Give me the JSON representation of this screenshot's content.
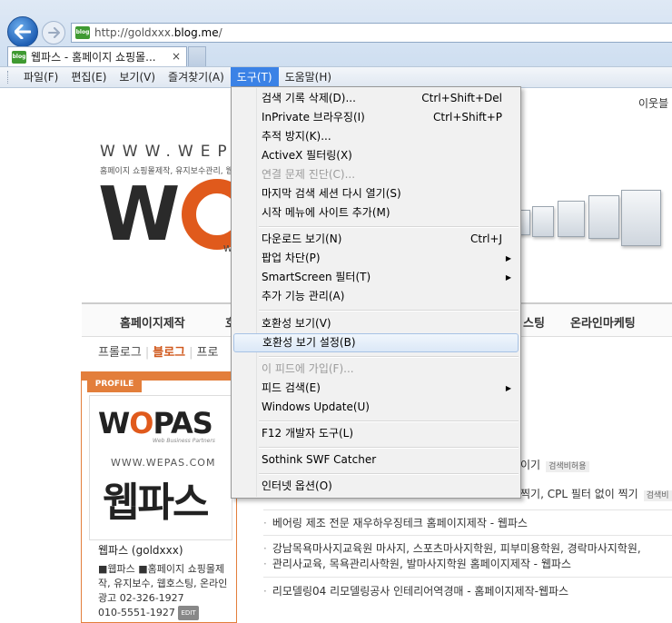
{
  "browser": {
    "address": "http://goldxxx.blog.me/",
    "address_prefix": "http://goldxxx.",
    "address_domain": "blog.me",
    "address_suffix": "/",
    "favicon_label": "blog",
    "tab_title": "웹파스 - 홈페이지 쇼핑몰...",
    "tab_close": "×"
  },
  "menubar": [
    {
      "label": "파일(F)"
    },
    {
      "label": "편집(E)"
    },
    {
      "label": "보기(V)"
    },
    {
      "label": "즐겨찾기(A)"
    },
    {
      "label": "도구(T)"
    },
    {
      "label": "도움말(H)"
    }
  ],
  "tools_menu": {
    "items": [
      {
        "label": "검색 기록 삭제(D)...",
        "shortcut": "Ctrl+Shift+Del"
      },
      {
        "label": "InPrivate 브라우징(I)",
        "shortcut": "Ctrl+Shift+P"
      },
      {
        "label": "추적 방지(K)...",
        "shortcut": ""
      },
      {
        "label": "ActiveX 필터링(X)",
        "shortcut": ""
      },
      {
        "label": "연결 문제 진단(C)...",
        "shortcut": ""
      },
      {
        "label": "마지막 검색 세션 다시 열기(S)",
        "shortcut": ""
      },
      {
        "label": "시작 메뉴에 사이트 추가(M)",
        "shortcut": ""
      },
      {
        "label": "다운로드 보기(N)",
        "shortcut": "Ctrl+J"
      },
      {
        "label": "팝업 차단(P)",
        "shortcut": ""
      },
      {
        "label": "SmartScreen 필터(T)",
        "shortcut": ""
      },
      {
        "label": "추가 기능 관리(A)",
        "shortcut": ""
      },
      {
        "label": "호환성 보기(V)",
        "shortcut": ""
      },
      {
        "label": "호환성 보기 설정(B)",
        "shortcut": ""
      },
      {
        "label": "이 피드에 가입(F)...",
        "shortcut": ""
      },
      {
        "label": "피드 검색(E)",
        "shortcut": ""
      },
      {
        "label": "Windows Update(U)",
        "shortcut": ""
      },
      {
        "label": "F12 개발자 도구(L)",
        "shortcut": ""
      },
      {
        "label": "Sothink SWF Catcher",
        "shortcut": ""
      },
      {
        "label": "인터넷 옵션(O)",
        "shortcut": ""
      }
    ]
  },
  "page": {
    "neighbor_label": "이웃블",
    "www_text": "WWW.WEPA",
    "tagline": "홈페이지 쇼핑몰제작, 유지보수관리, 웹",
    "big_logo_letter": "W",
    "big_logo_tail": "W",
    "site_nav": [
      "홈페이지제작",
      "호",
      "스팅",
      "온라인마케팅"
    ],
    "subnav": {
      "prologue": "프롤로그",
      "blog": "블로그",
      "third": "프로"
    },
    "profile": {
      "tab_label": "PROFILE",
      "logo_w": "W",
      "logo_o": "O",
      "logo_rest": "PAS",
      "logo_sub": "Web Business Partners",
      "www": "WWW.WEPAS.COM",
      "korean": "웹파스",
      "name": "웹파스 (goldxxx)",
      "desc": "■웹파스 ■홈페이지 쇼핑몰제작, 유지보수, 웹호스팅, 온라인광고 02-326-1927",
      "phone": "010-5551-1927",
      "edit_tag": "EDIT"
    },
    "posts": [
      {
        "text": "베어링 제조 전문 재우하우징테크 홈페이지제작 - 웹파스"
      },
      {
        "text": "강남목욕마사지교육원 마사지, 스포츠마사지학원, 피부미용학원, 경락마사지학원,"
      },
      {
        "text": "관리사교육, 목욕관리사학원, 발마사지학원 홈페이지제작 - 웹파스"
      },
      {
        "text": "리모델링04 리모델링공사 인테리어역경매 - 홈페이지제작-웹파스"
      }
    ],
    "right_snippets": {
      "a": "이기",
      "a_badge": "검색비허용",
      "b": "찍기, CPL 필터 없이 찍기",
      "b_badge": "검색비"
    }
  }
}
